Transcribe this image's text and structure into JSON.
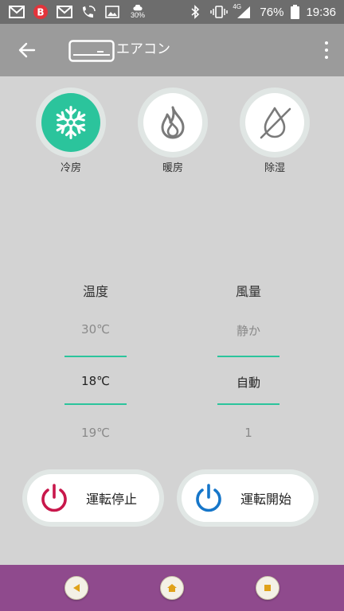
{
  "status_bar": {
    "battery_percent": "76%",
    "time": "19:36",
    "weather_percent": "30%",
    "network_label": "4G",
    "icons": [
      "gmail-icon",
      "app-b-icon",
      "gmail-icon",
      "wifi-calling-icon",
      "image-icon",
      "weather-icon",
      "bluetooth-icon",
      "vibrate-icon",
      "signal-icon",
      "battery-icon"
    ]
  },
  "app_bar": {
    "title": "エアコン",
    "back_icon": "arrow-left-icon",
    "device_icon": "air-conditioner-icon",
    "menu_icon": "more-vert-icon"
  },
  "modes": [
    {
      "label": "冷房",
      "icon": "snowflake-icon",
      "active": true
    },
    {
      "label": "暖房",
      "icon": "flame-icon",
      "active": false
    },
    {
      "label": "除湿",
      "icon": "dehumidify-icon",
      "active": false
    }
  ],
  "temperature": {
    "title": "温度",
    "prev": "30℃",
    "current": "18℃",
    "next": "19℃"
  },
  "fan": {
    "title": "風量",
    "prev": "静か",
    "current": "自動",
    "next": "1"
  },
  "buttons": {
    "stop_label": "運転停止",
    "start_label": "運転開始"
  },
  "colors": {
    "accent": "#2bc49c",
    "stop": "#c8174b",
    "start": "#1676c9",
    "nav_bar": "#8f4a8d",
    "app_bar": "#9b9b9b"
  }
}
